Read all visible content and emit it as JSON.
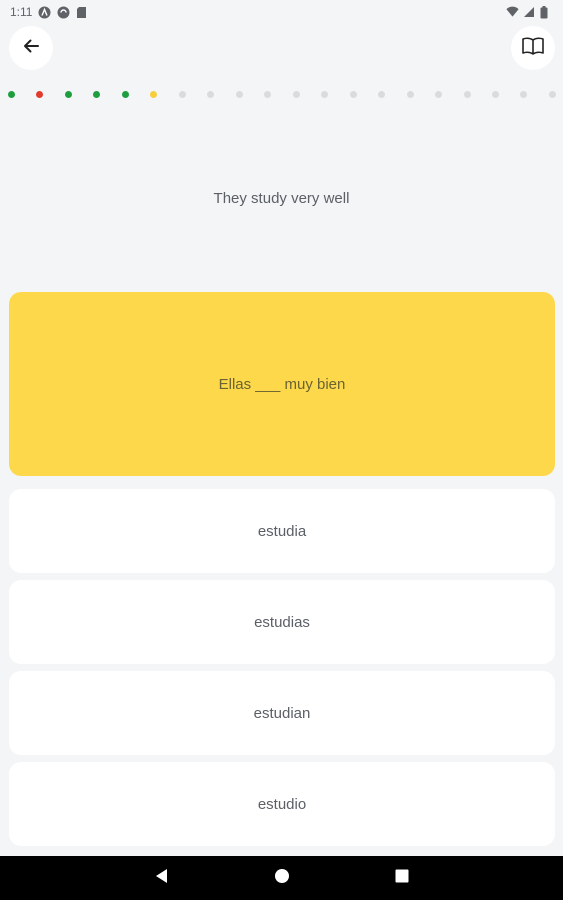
{
  "status_bar": {
    "time": "1:11",
    "icons": [
      "accessibility-icon",
      "sync-icon",
      "sd-card-icon",
      "wifi-icon",
      "signal-icon",
      "battery-icon"
    ]
  },
  "toolbar": {
    "back_icon": "arrow-left-icon",
    "book_icon": "open-book-icon"
  },
  "progress": {
    "colors": {
      "correct": "#1e9e3e",
      "wrong": "#e23b2e",
      "current": "#f7cf3b",
      "pending": "#d9dbde"
    },
    "dots": [
      "correct",
      "wrong",
      "correct",
      "correct",
      "correct",
      "current",
      "pending",
      "pending",
      "pending",
      "pending",
      "pending",
      "pending",
      "pending",
      "pending",
      "pending",
      "pending",
      "pending",
      "pending",
      "pending",
      "pending"
    ]
  },
  "exercise": {
    "prompt": "They study very well",
    "sentence": "Ellas ___ muy bien",
    "card_color": "#fdd84a",
    "options": [
      "estudia",
      "estudias",
      "estudian",
      "estudio"
    ]
  }
}
